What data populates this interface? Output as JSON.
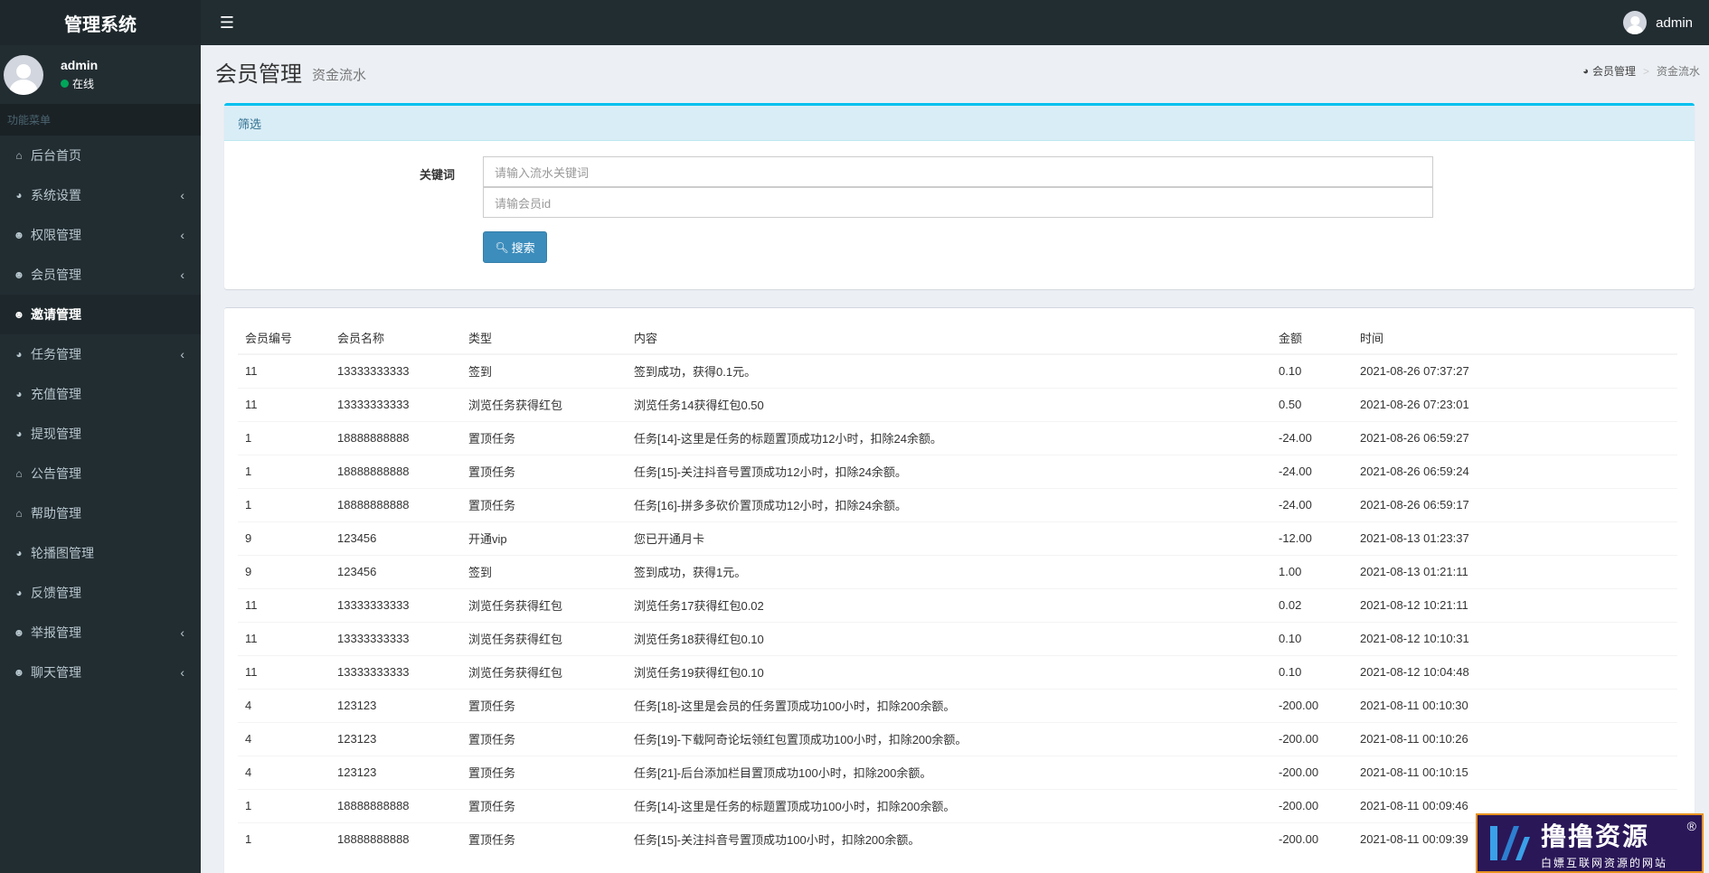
{
  "brand": "管理系统",
  "topbar": {
    "username": "admin"
  },
  "sidebar": {
    "user": {
      "name": "admin",
      "status": "在线"
    },
    "menu_header": "功能菜单",
    "items": [
      {
        "label": "后台首页",
        "icon": "home-icon",
        "has_children": false,
        "active": false
      },
      {
        "label": "系统设置",
        "icon": "dashboard-icon",
        "has_children": true,
        "active": false
      },
      {
        "label": "权限管理",
        "icon": "users-icon",
        "has_children": true,
        "active": false
      },
      {
        "label": "会员管理",
        "icon": "users-icon",
        "has_children": true,
        "active": false
      },
      {
        "label": "邀请管理",
        "icon": "users-icon",
        "has_children": false,
        "active": true
      },
      {
        "label": "任务管理",
        "icon": "dashboard-icon",
        "has_children": true,
        "active": false
      },
      {
        "label": "充值管理",
        "icon": "dashboard-icon",
        "has_children": false,
        "active": false
      },
      {
        "label": "提现管理",
        "icon": "dashboard-icon",
        "has_children": false,
        "active": false
      },
      {
        "label": "公告管理",
        "icon": "home-icon",
        "has_children": false,
        "active": false
      },
      {
        "label": "帮助管理",
        "icon": "home-icon",
        "has_children": false,
        "active": false
      },
      {
        "label": "轮播图管理",
        "icon": "dashboard-icon",
        "has_children": false,
        "active": false
      },
      {
        "label": "反馈管理",
        "icon": "dashboard-icon",
        "has_children": false,
        "active": false
      },
      {
        "label": "举报管理",
        "icon": "users-icon",
        "has_children": true,
        "active": false
      },
      {
        "label": "聊天管理",
        "icon": "users-icon",
        "has_children": true,
        "active": false
      }
    ]
  },
  "header": {
    "title": "会员管理",
    "subtitle": "资金流水"
  },
  "breadcrumb": [
    "会员管理",
    "资金流水"
  ],
  "filter": {
    "title": "筛选",
    "keyword_label": "关键词",
    "keyword_placeholder": "请输入流水关键词",
    "member_placeholder": "请输会员id",
    "search_label": "搜索"
  },
  "table": {
    "columns": [
      "会员编号",
      "会员名称",
      "类型",
      "内容",
      "金额",
      "时间"
    ],
    "rows": [
      [
        "11",
        "13333333333",
        "签到",
        "签到成功，获得0.1元。",
        "0.10",
        "2021-08-26 07:37:27"
      ],
      [
        "11",
        "13333333333",
        "浏览任务获得红包",
        "浏览任务14获得红包0.50",
        "0.50",
        "2021-08-26 07:23:01"
      ],
      [
        "1",
        "18888888888",
        "置顶任务",
        "任务[14]-这里是任务的标题置顶成功12小时，扣除24余额。",
        "-24.00",
        "2021-08-26 06:59:27"
      ],
      [
        "1",
        "18888888888",
        "置顶任务",
        "任务[15]-关注抖音号置顶成功12小时，扣除24余额。",
        "-24.00",
        "2021-08-26 06:59:24"
      ],
      [
        "1",
        "18888888888",
        "置顶任务",
        "任务[16]-拼多多砍价置顶成功12小时，扣除24余额。",
        "-24.00",
        "2021-08-26 06:59:17"
      ],
      [
        "9",
        "123456",
        "开通vip",
        "您已开通月卡",
        "-12.00",
        "2021-08-13 01:23:37"
      ],
      [
        "9",
        "123456",
        "签到",
        "签到成功，获得1元。",
        "1.00",
        "2021-08-13 01:21:11"
      ],
      [
        "11",
        "13333333333",
        "浏览任务获得红包",
        "浏览任务17获得红包0.02",
        "0.02",
        "2021-08-12 10:21:11"
      ],
      [
        "11",
        "13333333333",
        "浏览任务获得红包",
        "浏览任务18获得红包0.10",
        "0.10",
        "2021-08-12 10:10:31"
      ],
      [
        "11",
        "13333333333",
        "浏览任务获得红包",
        "浏览任务19获得红包0.10",
        "0.10",
        "2021-08-12 10:04:48"
      ],
      [
        "4",
        "123123",
        "置顶任务",
        "任务[18]-这里是会员的任务置顶成功100小时，扣除200余额。",
        "-200.00",
        "2021-08-11 00:10:30"
      ],
      [
        "4",
        "123123",
        "置顶任务",
        "任务[19]-下载阿奇论坛领红包置顶成功100小时，扣除200余额。",
        "-200.00",
        "2021-08-11 00:10:26"
      ],
      [
        "4",
        "123123",
        "置顶任务",
        "任务[21]-后台添加栏目置顶成功100小时，扣除200余额。",
        "-200.00",
        "2021-08-11 00:10:15"
      ],
      [
        "1",
        "18888888888",
        "置顶任务",
        "任务[14]-这里是任务的标题置顶成功100小时，扣除200余额。",
        "-200.00",
        "2021-08-11 00:09:46"
      ],
      [
        "1",
        "18888888888",
        "置顶任务",
        "任务[15]-关注抖音号置顶成功100小时，扣除200余额。",
        "-200.00",
        "2021-08-11 00:09:39"
      ]
    ]
  },
  "watermark": {
    "title": "撸撸资源",
    "subtitle": "白嫖互联网资源的网站"
  },
  "colors": {
    "sidebar": "#222d32",
    "primary": "#3c8dbc",
    "filter_head": "#d9edf7",
    "watermark_bg": "#2a1758",
    "watermark_border": "#e89321"
  }
}
